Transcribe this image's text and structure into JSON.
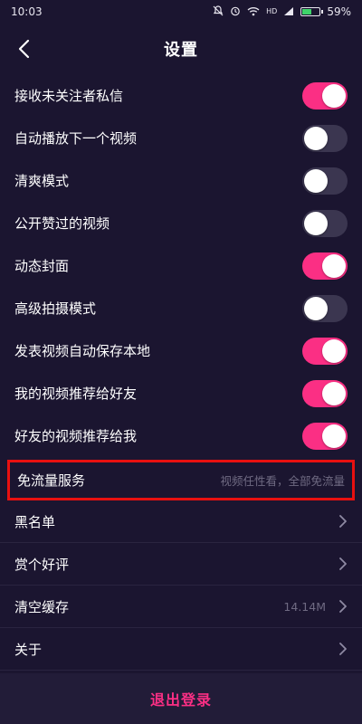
{
  "status_bar": {
    "time": "10:03",
    "signal_label": "HD",
    "battery_percent": "59%",
    "battery_level": 0.59
  },
  "header": {
    "title": "设置",
    "back_icon": "chevron-left-icon"
  },
  "toggles": [
    {
      "label": "接收未关注者私信",
      "on": true
    },
    {
      "label": "自动播放下一个视频",
      "on": false
    },
    {
      "label": "清爽模式",
      "on": false
    },
    {
      "label": "公开赞过的视频",
      "on": false
    },
    {
      "label": "动态封面",
      "on": true
    },
    {
      "label": "高级拍摄模式",
      "on": false
    },
    {
      "label": "发表视频自动保存本地",
      "on": true
    },
    {
      "label": "我的视频推荐给好友",
      "on": true
    },
    {
      "label": "好友的视频推荐给我",
      "on": true
    }
  ],
  "free_traffic": {
    "label": "免流量服务",
    "value": "视频任性看，全部免流量"
  },
  "links": [
    {
      "label": "黑名单",
      "value": ""
    },
    {
      "label": "赏个好评",
      "value": ""
    },
    {
      "label": "清空缓存",
      "value": "14.14M"
    },
    {
      "label": "关于",
      "value": ""
    }
  ],
  "footer": {
    "logout_label": "退出登录"
  },
  "colors": {
    "background": "#1b1530",
    "accent": "#fb2f84",
    "toggle_off": "#3b3650",
    "highlight": "#e81010"
  }
}
